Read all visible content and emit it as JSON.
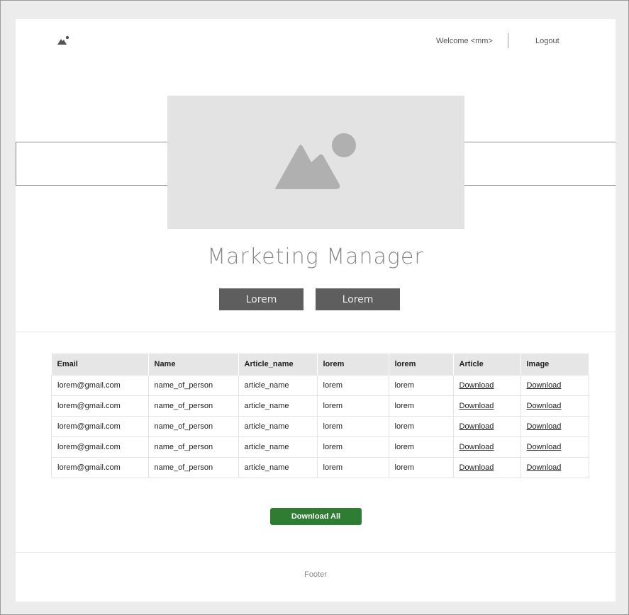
{
  "header": {
    "welcome": "Welcome <mm>",
    "logout": "Logout"
  },
  "hero": {
    "title": "Marketing Manager",
    "button_1": "Lorem",
    "button_2": "Lorem"
  },
  "table": {
    "headers": [
      "Email",
      "Name",
      "Article_name",
      "lorem",
      "lorem",
      "Article",
      "Image"
    ],
    "rows": [
      [
        "lorem@gmail.com",
        "name_of_person",
        "article_name",
        "lorem",
        "lorem",
        "Download",
        "Download"
      ],
      [
        "lorem@gmail.com",
        "name_of_person",
        "article_name",
        "lorem",
        "lorem",
        "Download",
        "Download"
      ],
      [
        "lorem@gmail.com",
        "name_of_person",
        "article_name",
        "lorem",
        "lorem",
        "Download",
        "Download"
      ],
      [
        "lorem@gmail.com",
        "name_of_person",
        "article_name",
        "lorem",
        "lorem",
        "Download",
        "Download"
      ],
      [
        "lorem@gmail.com",
        "name_of_person",
        "article_name",
        "lorem",
        "lorem",
        "Download",
        "Download"
      ]
    ]
  },
  "download_all": "Download All",
  "footer": "Footer",
  "colors": {
    "accent_green": "#2e7d32",
    "button_gray": "#5e5e5e",
    "placeholder_gray": "#e3e3e3"
  }
}
